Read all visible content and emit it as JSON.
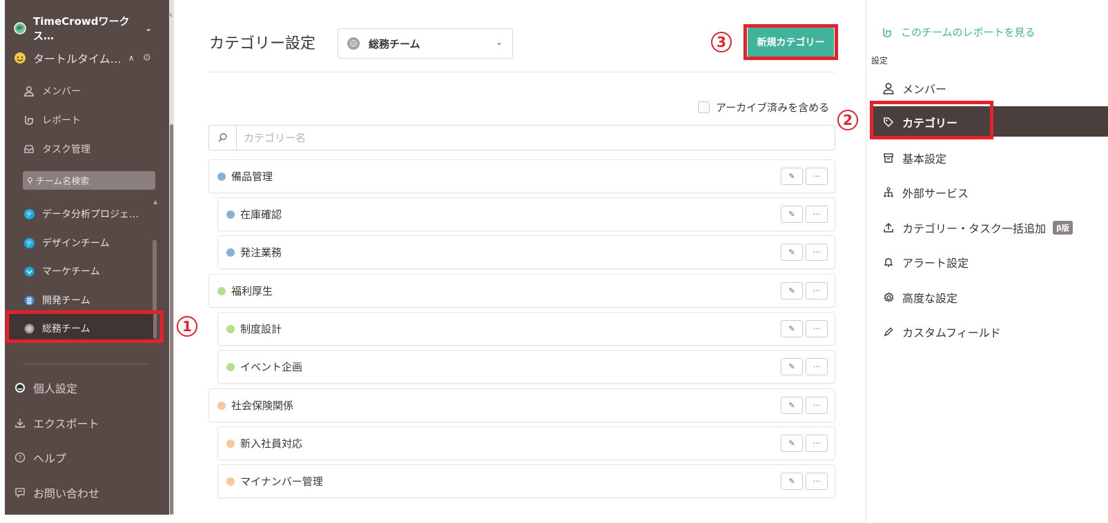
{
  "sidebar": {
    "workspace_name": "TimeCrowdワークス…",
    "current_team": "タートルタイム…",
    "menu": [
      {
        "label": "メンバー",
        "icon": "person-icon"
      },
      {
        "label": "レポート",
        "icon": "report-icon"
      },
      {
        "label": "タスク管理",
        "icon": "inbox-icon"
      }
    ],
    "team_search_placeholder": "チーム名検索",
    "teams": [
      {
        "label": "データ分析プロジェ…",
        "icon_letter": "テ",
        "color": "#1fa9d8"
      },
      {
        "label": "デザインチーム",
        "icon_letter": "テ",
        "color": "#1fa9d8"
      },
      {
        "label": "マーケチーム",
        "icon_letter": "",
        "color": "#1fa9d8"
      },
      {
        "label": "開発チーム",
        "icon_letter": "",
        "color": "#4a8ed6"
      },
      {
        "label": "総務チーム",
        "icon_letter": "",
        "color": "#9a9694"
      }
    ],
    "bottom": [
      {
        "label": "個人設定",
        "icon": "avatar-icon"
      },
      {
        "label": "エクスポート",
        "icon": "download-icon"
      },
      {
        "label": "ヘルプ",
        "icon": "help-icon"
      },
      {
        "label": "お問い合わせ",
        "icon": "chat-icon"
      }
    ]
  },
  "annotations": {
    "one": "1",
    "two": "2",
    "three": "3"
  },
  "main": {
    "title": "カテゴリー設定",
    "team_select_value": "総務チーム",
    "new_category_button": "新規カテゴリー",
    "archive_checkbox_label": "アーカイブ済みを含める",
    "search_placeholder": "カテゴリー名",
    "categories": [
      {
        "label": "備品管理",
        "color": "#8aaedc",
        "child": false
      },
      {
        "label": "在庫確認",
        "color": "#8aaedc",
        "child": true
      },
      {
        "label": "発注業務",
        "color": "#8aaedc",
        "child": true
      },
      {
        "label": "福利厚生",
        "color": "#b4df8f",
        "child": false
      },
      {
        "label": "制度設計",
        "color": "#b4df8f",
        "child": true
      },
      {
        "label": "イベント企画",
        "color": "#b4df8f",
        "child": true
      },
      {
        "label": "社会保険関係",
        "color": "#f5c89a",
        "child": false
      },
      {
        "label": "新入社員対応",
        "color": "#f5c89a",
        "child": true
      },
      {
        "label": "マイナンバー管理",
        "color": "#f5c89a",
        "child": true
      }
    ],
    "edit_icon": "✎",
    "more_icon": "···"
  },
  "right_panel": {
    "report_link": "このチームのレポートを見る",
    "section_label": "設定",
    "items": [
      {
        "label": "メンバー",
        "icon": "person-icon"
      },
      {
        "label": "カテゴリー",
        "icon": "tag-icon",
        "active": true
      },
      {
        "label": "基本設定",
        "icon": "box-icon"
      },
      {
        "label": "外部サービス",
        "icon": "network-icon"
      },
      {
        "label": "カテゴリー・タスク一括追加",
        "icon": "upload-icon",
        "badge": "β版"
      },
      {
        "label": "アラート設定",
        "icon": "bell-icon"
      },
      {
        "label": "高度な設定",
        "icon": "gear-icon"
      },
      {
        "label": "カスタムフィールド",
        "icon": "pencil-icon"
      }
    ]
  },
  "colors": {
    "accent": "#40b49a",
    "annotation_red": "#e6212b",
    "sidebar_bg": "#574a46"
  }
}
